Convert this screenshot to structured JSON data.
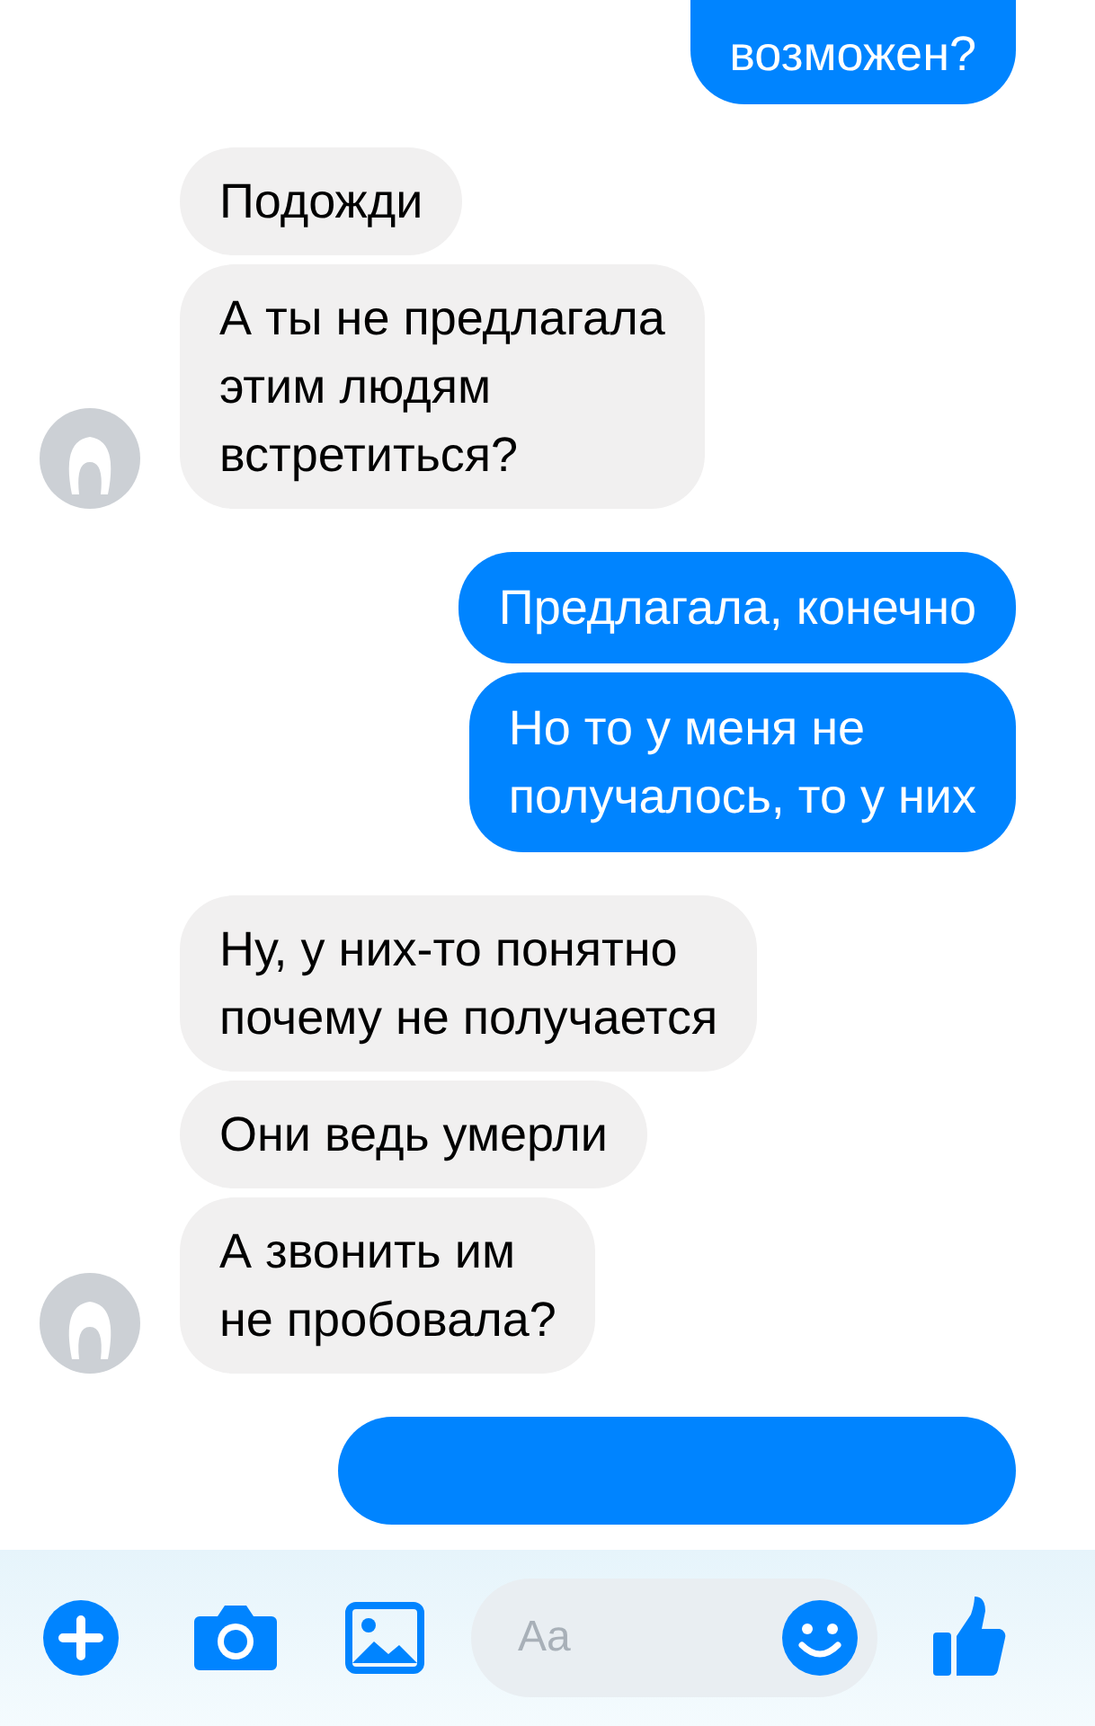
{
  "groups": [
    {
      "kind": "out",
      "messages": [
        "возможен?"
      ]
    },
    {
      "kind": "in",
      "messages": [
        "Подожди",
        "А ты не предлагала\nэтим людям\nвстретиться?"
      ]
    },
    {
      "kind": "out",
      "messages": [
        "Предлагала, конечно",
        "Но то у меня не\nполучалось, то у них"
      ]
    },
    {
      "kind": "in",
      "messages": [
        "Ну, у них-то понятно\nпочему не получается",
        "Они ведь умерли",
        "А звонить им\nне пробовала?"
      ]
    }
  ],
  "composer": {
    "placeholder": "Aa"
  }
}
